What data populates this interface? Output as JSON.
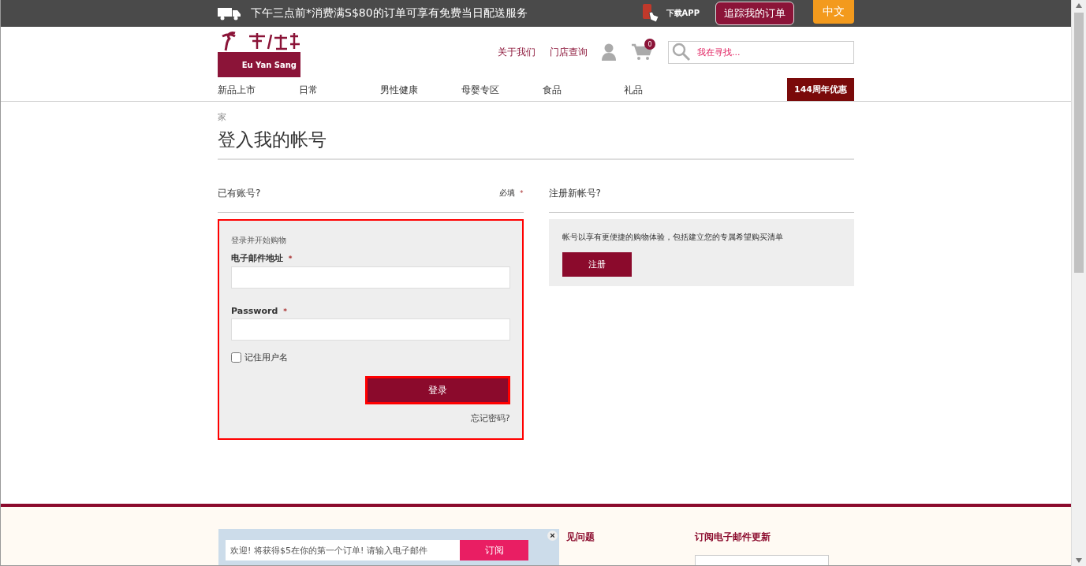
{
  "top_bar": {
    "shipping_notice": "下午三点前*消费满S$80的订单可享有免费当日配送服务",
    "app_link": "下载APP",
    "track_order_button": "追踪我的订单",
    "language_button": "中文"
  },
  "header": {
    "logo_text": "Eu Yan Sang",
    "links": [
      "关于我们",
      "门店查询"
    ],
    "cart_count": "0",
    "search": {
      "placeholder": "我在寻找..."
    }
  },
  "nav": {
    "items": [
      "新品上市",
      "日常",
      "男性健康",
      "母婴专区",
      "食品",
      "礼品"
    ],
    "promo_button": "144周年优惠"
  },
  "breadcrumb": [
    "家"
  ],
  "page_title": "登入我的帐号",
  "login": {
    "heading": "已有账号?",
    "required_note": "必填",
    "intro": "登录并开始购物",
    "required_mark": "*",
    "fields": [
      {
        "label": "电子邮件地址",
        "required": true
      },
      {
        "label": "Password",
        "required": true
      }
    ],
    "remember": {
      "label": "记住用户名",
      "checked": false
    },
    "submit_button": "登录",
    "forgot_link": "忘记密码?"
  },
  "register": {
    "heading": "注册新帐号?",
    "text": "帐号以享有更便捷的购物体验，包括建立您的专属希望购买清单",
    "button": "注册"
  },
  "footer": {
    "headings": [
      {
        "text": "见问题"
      },
      {
        "text": "订阅电子邮件更新"
      }
    ]
  },
  "popup": {
    "placeholder": "欢迎! 将获得$5在你的第一个订单! 请输入电子邮件",
    "button": "订阅",
    "close": "×"
  }
}
